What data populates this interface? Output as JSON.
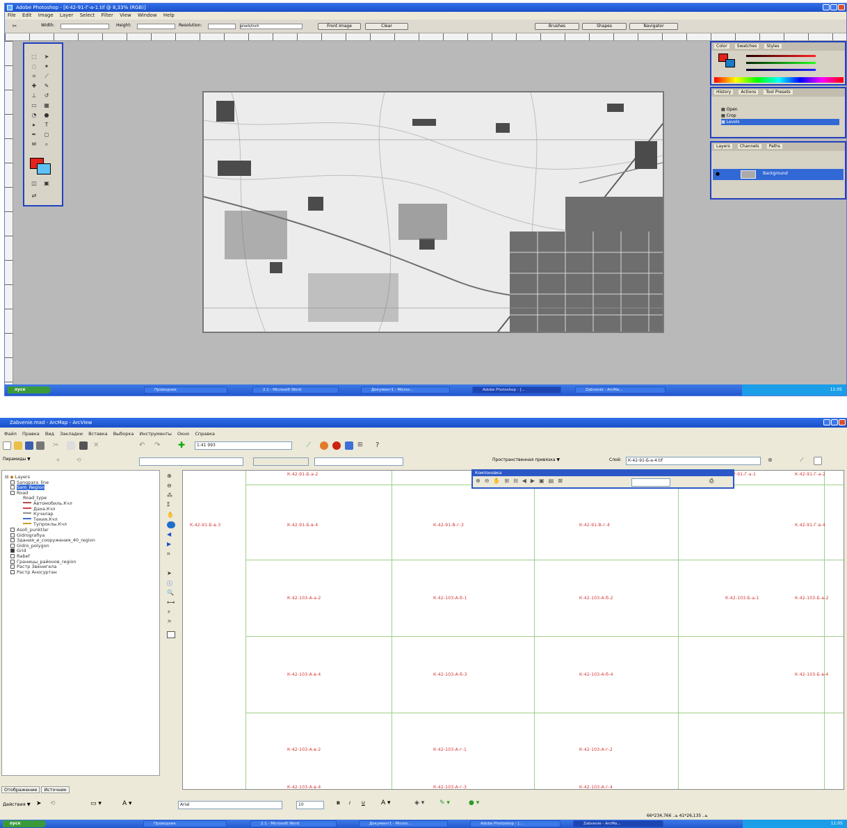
{
  "photoshop": {
    "title": "Adobe Photoshop - [K-42-91-Г-a-1.tif @ 8,33% (RGB)]",
    "menu": [
      "File",
      "Edit",
      "Image",
      "Layer",
      "Select",
      "Filter",
      "View",
      "Window",
      "Help"
    ],
    "options": {
      "width_label": "Width:",
      "height_label": "Height:",
      "resolution_label": "Resolution:",
      "resolution_unit": "pixels/inch",
      "front_image_btn": "Front Image",
      "clear_btn": "Clear"
    },
    "palette_tabs": {
      "color": [
        "Color",
        "Swatches",
        "Styles"
      ],
      "history": [
        "History",
        "Actions",
        "Tool Presets"
      ],
      "layers": [
        "Layers",
        "Channels",
        "Paths"
      ]
    },
    "history_items": [
      "Open",
      "Crop",
      "Levels"
    ],
    "layer_name": "Background",
    "top_palette_tabs": [
      "Brushes",
      "Shapes",
      "Navigator"
    ],
    "colors": {
      "foreground": "#e3221c",
      "background": "#5ec2f3"
    }
  },
  "arcmap": {
    "title": "Zabvenie.mxd - ArcMap - ArcView",
    "menu": [
      "Файл",
      "Правка",
      "Вид",
      "Закладки",
      "Вставка",
      "Выборка",
      "Инструменты",
      "Окно",
      "Справка"
    ],
    "scale": "1:41 993",
    "spatial_adjust_label": "Пространственная привязка ▼",
    "layer_combo_label": "Слой:",
    "layer_combo_value": "К-42-91-Б-а-4.tif",
    "editor_title": "Компоновка",
    "toc": {
      "root": "Layers",
      "items": [
        {
          "label": "Sangpara_line",
          "checked": false
        },
        {
          "label": "Sam_Region",
          "checked": false,
          "selected": true
        },
        {
          "label": "Road",
          "checked": false,
          "expanded": true
        },
        {
          "label": "Road_type",
          "sub": true
        },
        {
          "label": "Автомобиль.Кчл",
          "sub": true,
          "legend": "#b04848"
        },
        {
          "label": "Даха.Кчл",
          "sub": true,
          "legend": "#d04040"
        },
        {
          "label": "Кучалар",
          "sub": true,
          "legend": "#909090"
        },
        {
          "label": "Текия.Кчл",
          "sub": true,
          "legend": "#3b6bc8"
        },
        {
          "label": "Тупроклы.Кчл",
          "sub": true,
          "legend": "#c89a30"
        },
        {
          "label": "Asoll_punktlar",
          "checked": false
        },
        {
          "label": "Gidrografiya",
          "checked": false
        },
        {
          "label": "Здания_и_сооружения_40_region",
          "checked": false
        },
        {
          "label": "Gidro_polygon",
          "checked": false
        },
        {
          "label": "Grid",
          "checked": true
        },
        {
          "label": "Rabef",
          "checked": false
        },
        {
          "label": "Границы_районов_region",
          "checked": false
        },
        {
          "label": "Растр Звенигела",
          "checked": false
        },
        {
          "label": "Растр Аносуртан",
          "checked": false
        }
      ]
    },
    "toc_tabs": [
      "Отображение",
      "Источник"
    ],
    "draw_label": "Действия ▼",
    "font_name": "Arial",
    "font_size": "10",
    "status_coords": "66*234,766 ..ь  41*26,135 ..ь",
    "sheet_labels": [
      {
        "text": "К-42-91-Б-а-2",
        "c": 1,
        "r": 0
      },
      {
        "text": "К-42-91-Г-а-1",
        "c": 4,
        "r": 0
      },
      {
        "text": "К-42-91-Г-а-2",
        "c": 5,
        "r": 0
      },
      {
        "text": "К-42-91-Б-в-3",
        "c": 0,
        "r": 1
      },
      {
        "text": "К-42-91-Б-в-4",
        "c": 1,
        "r": 1
      },
      {
        "text": "К-42-91-В-г-3",
        "c": 2,
        "r": 1
      },
      {
        "text": "К-42-91-В-г-4",
        "c": 3,
        "r": 1
      },
      {
        "text": "К-42-91-Г-в-4",
        "c": 5,
        "r": 1
      },
      {
        "text": "К-42-103-А-а-2",
        "c": 1,
        "r": 2
      },
      {
        "text": "К-42-103-А-б-1",
        "c": 2,
        "r": 2
      },
      {
        "text": "К-42-103-А-б-2",
        "c": 3,
        "r": 2
      },
      {
        "text": "К-42-103-Б-а-1",
        "c": 4,
        "r": 2
      },
      {
        "text": "К-42-103-Б-а-2",
        "c": 5,
        "r": 2
      },
      {
        "text": "К-42-103-А-в-4",
        "c": 1,
        "r": 3
      },
      {
        "text": "К-42-103-А-б-3",
        "c": 2,
        "r": 3
      },
      {
        "text": "К-42-103-А-б-4",
        "c": 3,
        "r": 3
      },
      {
        "text": "К-42-103-Б-в-4",
        "c": 5,
        "r": 3
      },
      {
        "text": "К-42-103-А-в-2",
        "c": 1,
        "r": 4
      },
      {
        "text": "К-42-103-А-г-1",
        "c": 2,
        "r": 4
      },
      {
        "text": "К-42-103-А-г-2",
        "c": 3,
        "r": 4
      },
      {
        "text": "К-42-103-А-в-4",
        "c": 1,
        "r": 5
      },
      {
        "text": "К-42-103-А-г-3",
        "c": 2,
        "r": 5
      },
      {
        "text": "К-42-103-А-г-4",
        "c": 3,
        "r": 5
      }
    ]
  },
  "taskbar": {
    "start": "пуск",
    "buttons": [
      "Проводник",
      "2.1 - Microsoft Word",
      "Документ1 - Micros...",
      "Adobe Photoshop - [...",
      "Zabvenie - ArcMa..."
    ],
    "clock": "11:05"
  }
}
